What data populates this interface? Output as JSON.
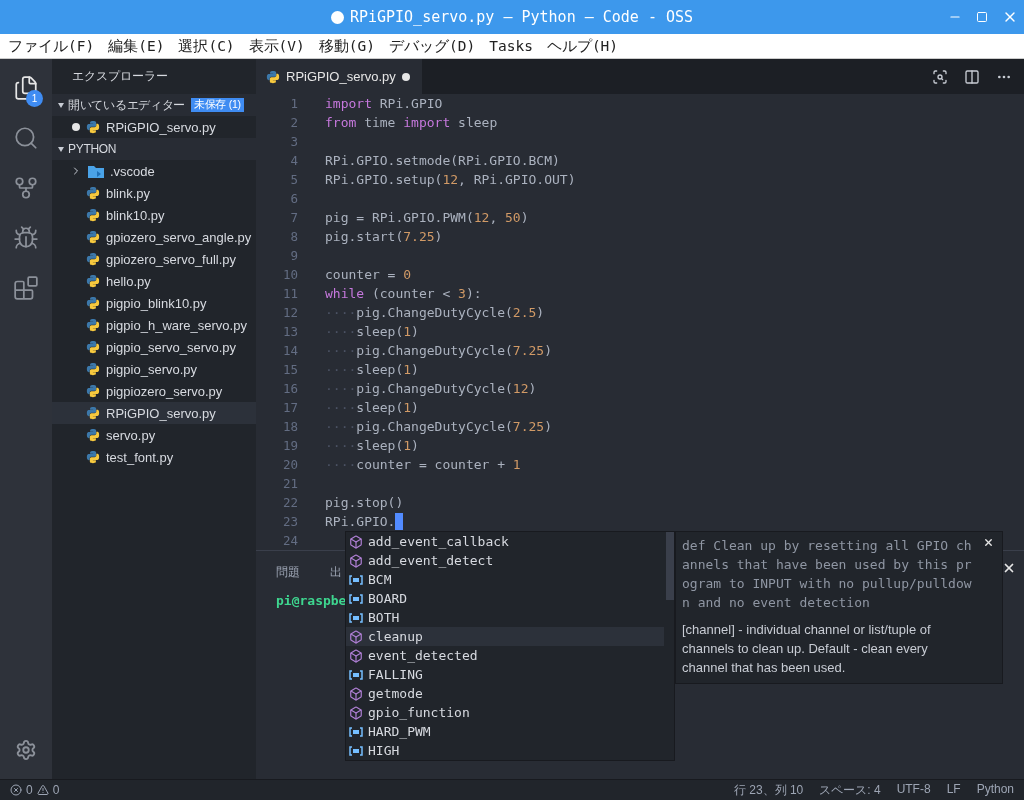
{
  "window": {
    "title": "RPiGPIO_servo.py — Python — Code - OSS",
    "dirty": true
  },
  "menu": [
    "ファイル(F)",
    "編集(E)",
    "選択(C)",
    "表示(V)",
    "移動(G)",
    "デバッグ(D)",
    "Tasks",
    "ヘルプ(H)"
  ],
  "activity_bar": [
    {
      "kind": "explorer",
      "selected": true,
      "badge": "1"
    },
    {
      "kind": "search",
      "selected": false
    },
    {
      "kind": "source-control",
      "selected": false
    },
    {
      "kind": "debug",
      "selected": false
    },
    {
      "kind": "extensions",
      "selected": false
    },
    {
      "kind": "settings",
      "selected": false
    }
  ],
  "sidebar": {
    "title": "エクスプローラー",
    "sections": [
      {
        "title": "開いているエディター",
        "expanded": true,
        "badge": "未保存 (1)",
        "items": [
          {
            "label": "RPiGPIO_servo.py",
            "kind": "file",
            "dirty": true,
            "selected": false
          }
        ]
      },
      {
        "title": "PYTHON",
        "expanded": true,
        "items": [
          {
            "label": ".vscode",
            "kind": "folder",
            "expanded": false,
            "selected": false
          },
          {
            "label": "blink.py",
            "kind": "file",
            "selected": false
          },
          {
            "label": "blink10.py",
            "kind": "file",
            "selected": false
          },
          {
            "label": "gpiozero_servo_angle.py",
            "kind": "file",
            "selected": false
          },
          {
            "label": "gpiozero_servo_full.py",
            "kind": "file",
            "selected": false
          },
          {
            "label": "hello.py",
            "kind": "file",
            "selected": false
          },
          {
            "label": "pigpio_blink10.py",
            "kind": "file",
            "selected": false
          },
          {
            "label": "pigpio_h_ware_servo.py",
            "kind": "file",
            "selected": false
          },
          {
            "label": "pigpio_servo_servo.py",
            "kind": "file",
            "selected": false
          },
          {
            "label": "pigpio_servo.py",
            "kind": "file",
            "selected": false
          },
          {
            "label": "pigpiozero_servo.py",
            "kind": "file",
            "selected": false
          },
          {
            "label": "RPiGPIO_servo.py",
            "kind": "file",
            "selected": true
          },
          {
            "label": "servo.py",
            "kind": "file",
            "selected": false
          },
          {
            "label": "test_font.py",
            "kind": "file",
            "selected": false
          }
        ]
      }
    ]
  },
  "editor": {
    "tabs": [
      {
        "label": "RPiGPIO_servo.py",
        "dirty": true,
        "selected": true
      }
    ],
    "lines": [
      {
        "number": "1",
        "tokens": [
          {
            "kind": "keyword",
            "text": "import"
          },
          {
            "kind": "plain",
            "text": " RPi.GPIO"
          }
        ]
      },
      {
        "number": "2",
        "tokens": [
          {
            "kind": "keyword",
            "text": "from"
          },
          {
            "kind": "plain",
            "text": " time "
          },
          {
            "kind": "keyword",
            "text": "import"
          },
          {
            "kind": "plain",
            "text": " sleep"
          }
        ]
      },
      {
        "number": "3"
      },
      {
        "number": "4",
        "tokens": [
          {
            "kind": "plain",
            "text": "RPi.GPIO.setmode(RPi.GPIO.BCM)"
          }
        ]
      },
      {
        "number": "5",
        "tokens": [
          {
            "kind": "plain",
            "text": "RPi.GPIO.setup("
          },
          {
            "kind": "number",
            "text": "12"
          },
          {
            "kind": "plain",
            "text": ", RPi.GPIO.OUT)"
          }
        ]
      },
      {
        "number": "6"
      },
      {
        "number": "7",
        "tokens": [
          {
            "kind": "plain",
            "text": "pig = RPi.GPIO.PWM("
          },
          {
            "kind": "number",
            "text": "12"
          },
          {
            "kind": "plain",
            "text": ", "
          },
          {
            "kind": "number",
            "text": "50"
          },
          {
            "kind": "plain",
            "text": ")"
          }
        ]
      },
      {
        "number": "8",
        "tokens": [
          {
            "kind": "plain",
            "text": "pig.start("
          },
          {
            "kind": "number",
            "text": "7.25"
          },
          {
            "kind": "plain",
            "text": ")"
          }
        ]
      },
      {
        "number": "9"
      },
      {
        "number": "10",
        "tokens": [
          {
            "kind": "plain",
            "text": "counter = "
          },
          {
            "kind": "number",
            "text": "0"
          }
        ]
      },
      {
        "number": "11",
        "tokens": [
          {
            "kind": "keyword",
            "text": "while"
          },
          {
            "kind": "plain",
            "text": " (counter < "
          },
          {
            "kind": "number",
            "text": "3"
          },
          {
            "kind": "plain",
            "text": "):"
          }
        ]
      },
      {
        "number": "12",
        "tokens": [
          {
            "kind": "whitespace",
            "text": "····"
          },
          {
            "kind": "plain",
            "text": "pig.ChangeDutyCycle("
          },
          {
            "kind": "number",
            "text": "2.5"
          },
          {
            "kind": "plain",
            "text": ")"
          }
        ]
      },
      {
        "number": "13",
        "tokens": [
          {
            "kind": "whitespace",
            "text": "····"
          },
          {
            "kind": "plain",
            "text": "sleep("
          },
          {
            "kind": "number",
            "text": "1"
          },
          {
            "kind": "plain",
            "text": ")"
          }
        ]
      },
      {
        "number": "14",
        "tokens": [
          {
            "kind": "whitespace",
            "text": "····"
          },
          {
            "kind": "plain",
            "text": "pig.ChangeDutyCycle("
          },
          {
            "kind": "number",
            "text": "7.25"
          },
          {
            "kind": "plain",
            "text": ")"
          }
        ]
      },
      {
        "number": "15",
        "tokens": [
          {
            "kind": "whitespace",
            "text": "····"
          },
          {
            "kind": "plain",
            "text": "sleep("
          },
          {
            "kind": "number",
            "text": "1"
          },
          {
            "kind": "plain",
            "text": ")"
          }
        ]
      },
      {
        "number": "16",
        "tokens": [
          {
            "kind": "whitespace",
            "text": "····"
          },
          {
            "kind": "plain",
            "text": "pig.ChangeDutyCycle("
          },
          {
            "kind": "number",
            "text": "12"
          },
          {
            "kind": "plain",
            "text": ")"
          }
        ]
      },
      {
        "number": "17",
        "tokens": [
          {
            "kind": "whitespace",
            "text": "····"
          },
          {
            "kind": "plain",
            "text": "sleep("
          },
          {
            "kind": "number",
            "text": "1"
          },
          {
            "kind": "plain",
            "text": ")"
          }
        ]
      },
      {
        "number": "18",
        "tokens": [
          {
            "kind": "whitespace",
            "text": "····"
          },
          {
            "kind": "plain",
            "text": "pig.ChangeDutyCycle("
          },
          {
            "kind": "number",
            "text": "7.25"
          },
          {
            "kind": "plain",
            "text": ")"
          }
        ]
      },
      {
        "number": "19",
        "tokens": [
          {
            "kind": "whitespace",
            "text": "····"
          },
          {
            "kind": "plain",
            "text": "sleep("
          },
          {
            "kind": "number",
            "text": "1"
          },
          {
            "kind": "plain",
            "text": ")"
          }
        ]
      },
      {
        "number": "20",
        "tokens": [
          {
            "kind": "whitespace",
            "text": "····"
          },
          {
            "kind": "plain",
            "text": "counter = counter + "
          },
          {
            "kind": "number",
            "text": "1"
          }
        ]
      },
      {
        "number": "21"
      },
      {
        "number": "22",
        "tokens": [
          {
            "kind": "plain",
            "text": "pig.stop()"
          }
        ]
      },
      {
        "number": "23",
        "tokens": [
          {
            "kind": "plain",
            "text": "RPi.GPIO."
          }
        ],
        "cursor": true
      },
      {
        "number": "24"
      }
    ]
  },
  "panel": {
    "tabs": [
      "問題",
      "出"
    ],
    "terminal": "pi@raspbe"
  },
  "suggestions": [
    {
      "label": "add_event_callback",
      "kind": "method",
      "selected": false
    },
    {
      "label": "add_event_detect",
      "kind": "method",
      "selected": false
    },
    {
      "label": "BCM",
      "kind": "constant",
      "selected": false
    },
    {
      "label": "BOARD",
      "kind": "constant",
      "selected": false
    },
    {
      "label": "BOTH",
      "kind": "constant",
      "selected": false
    },
    {
      "label": "cleanup",
      "kind": "method",
      "selected": true
    },
    {
      "label": "event_detected",
      "kind": "method",
      "selected": false
    },
    {
      "label": "FALLING",
      "kind": "constant",
      "selected": false
    },
    {
      "label": "getmode",
      "kind": "method",
      "selected": false
    },
    {
      "label": "gpio_function",
      "kind": "method",
      "selected": false
    },
    {
      "label": "HARD_PWM",
      "kind": "constant",
      "selected": false
    },
    {
      "label": "HIGH",
      "kind": "constant",
      "selected": false
    }
  ],
  "details": {
    "signature": "def Clean up by resetting all GPIO channels that have been used by this program to INPUT with no pullup/pulldown and no event detection",
    "description": "[channel] - individual channel or list/tuple of channels to clean up.  Default - clean every channel that has been used."
  },
  "status_bar": {
    "errors": "0",
    "warnings": "0",
    "items": [
      "行 23、列 10",
      "スペース: 4",
      "UTF-8",
      "LF",
      "Python"
    ]
  }
}
